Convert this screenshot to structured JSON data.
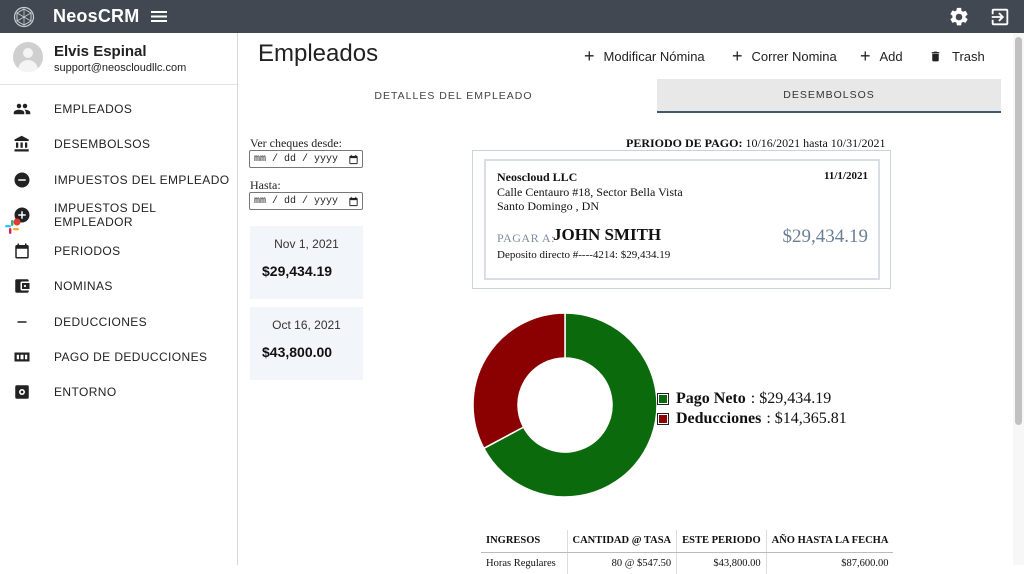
{
  "app": {
    "brand": "NeosCRM"
  },
  "user": {
    "name": "Elvis Espinal",
    "email": "support@neoscloudllc.com"
  },
  "sidebar": {
    "items": [
      {
        "label": "EMPLEADOS",
        "icon": "people-icon"
      },
      {
        "label": "DESEMBOLSOS",
        "icon": "bank-icon"
      },
      {
        "label": "IMPUESTOS DEL EMPLEADO",
        "icon": "minus-circle-icon"
      },
      {
        "label": "IMPUESTOS DEL EMPLEADOR",
        "icon": "plus-circle-icon"
      },
      {
        "label": "PERIODOS",
        "icon": "calendar-icon"
      },
      {
        "label": "NOMINAS",
        "icon": "wallet-icon"
      },
      {
        "label": "DEDUCCIONES",
        "icon": "minus-icon"
      },
      {
        "label": "PAGO DE DEDUCCIONES",
        "icon": "counter-icon"
      },
      {
        "label": "ENTORNO",
        "icon": "settings-box-icon"
      }
    ]
  },
  "main": {
    "title": "Empleados",
    "toolbar": {
      "modify_payroll": "Modificar Nómina",
      "run_payroll": "Correr Nomina",
      "add": "Add",
      "trash": "Trash"
    },
    "tabs": [
      {
        "label": "DETALLES DEL EMPLEADO",
        "active": false
      },
      {
        "label": "DESEMBOLSOS",
        "active": true
      }
    ]
  },
  "filters": {
    "from_label": "Ver cheques desde:",
    "from_placeholder": "mm / dd / yyyy",
    "to_label": "Hasta:",
    "to_placeholder": "mm / dd / yyyy"
  },
  "stubs": [
    {
      "date": "Nov 1, 2021",
      "amount": "$29,434.19"
    },
    {
      "date": "Oct 16, 2021",
      "amount": "$43,800.00"
    }
  ],
  "pay_period": {
    "label": "PERIODO DE PAGO:",
    "value": "10/16/2021 hasta 10/31/2021"
  },
  "check": {
    "company": "Neoscloud LLC",
    "address_line1": "Calle Centauro #18, Sector Bella Vista",
    "address_line2": "Santo Domingo , DN",
    "date": "11/1/2021",
    "pay_to_label": "PAGAR A:",
    "payee": "JOHN SMITH",
    "amount": "$29,434.19",
    "deposit_line": "Deposito directo #----4214: $29,434.19"
  },
  "chart_data": {
    "type": "pie",
    "donut": true,
    "labels": [
      "Pago Neto",
      "Deducciones"
    ],
    "values": [
      29434.19,
      14365.81
    ],
    "value_labels": [
      "$29,434.19",
      "$14,365.81"
    ],
    "colors": [
      "#0b6a0b",
      "#8b0000"
    ],
    "legend_position": "right"
  },
  "earnings_table": {
    "headers": [
      "INGRESOS",
      "CANTIDAD @ TASA",
      "ESTE PERIODO",
      "AÑO HASTA LA FECHA"
    ],
    "rows": [
      [
        "Horas Regulares",
        "80 @ $547.50",
        "$43,800.00",
        "$87,600.00"
      ]
    ]
  }
}
